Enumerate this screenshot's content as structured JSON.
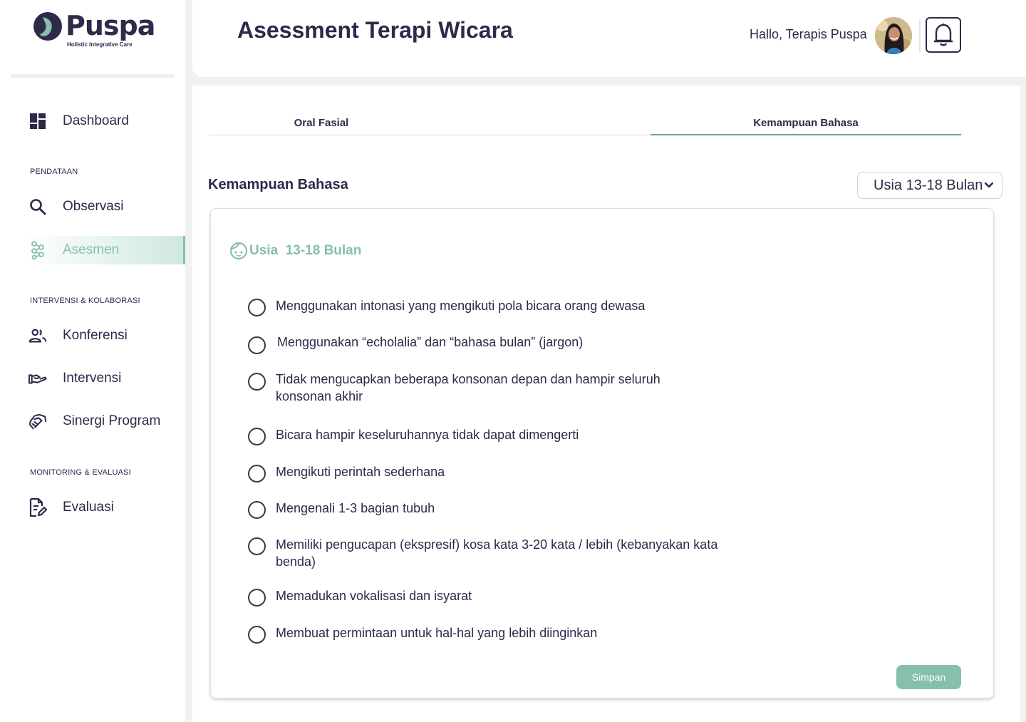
{
  "brand": {
    "name": "Puspa",
    "tagline": "Holistic Integrative Care",
    "accent": "#86bfac",
    "primary": "#2d2a4a"
  },
  "sidebar": {
    "dashboard": {
      "label": "Dashboard",
      "icon": "dashboard-icon"
    },
    "section_pendataan": "PENDATAAN",
    "observasi": {
      "label": "Observasi",
      "icon": "search-icon"
    },
    "asesmen": {
      "label": "Asesmen",
      "icon": "molecule-icon",
      "active": true
    },
    "section_intervensi": "INTERVENSI & KOLABORASI",
    "konferensi": {
      "label": "Konferensi",
      "icon": "people-icon"
    },
    "intervensi": {
      "label": "Intervensi",
      "icon": "helping-hand-icon"
    },
    "sinergi": {
      "label": "Sinergi Program",
      "icon": "handshake-icon"
    },
    "section_monitoring": "MONITORING & EVALUASI",
    "evaluasi": {
      "label": "Evaluasi",
      "icon": "document-edit-icon"
    }
  },
  "header": {
    "title": "Asessment Terapi Wicara",
    "greeting": "Hallo, Terapis Puspa"
  },
  "tabs": [
    {
      "label": "Oral Fasial",
      "active": false
    },
    {
      "label": "Kemampuan Bahasa",
      "active": true
    }
  ],
  "section": {
    "heading": "Kemampuan Bahasa",
    "age_select": "Usia 13-18 Bulan"
  },
  "card": {
    "title": "Usia  13-18 Bulan",
    "questions": [
      "Menggunakan intonasi yang mengikuti pola bicara orang dewasa",
      "Menggunakan “echolalia” dan “bahasa bulan” (jargon)",
      "Tidak mengucapkan beberapa konsonan depan dan hampir seluruh konsonan akhir",
      "Bicara hampir keseluruhannya tidak dapat dimengerti",
      "Mengikuti perintah sederhana",
      "Mengenali 1-3 bagian tubuh",
      "Memiliki pengucapan (ekspresif) kosa kata 3-20 kata / lebih (kebanyakan kata benda)",
      "Memadukan vokalisasi dan isyarat",
      "Membuat permintaan untuk hal-hal yang lebih diinginkan"
    ],
    "save_label": "Simpan"
  }
}
